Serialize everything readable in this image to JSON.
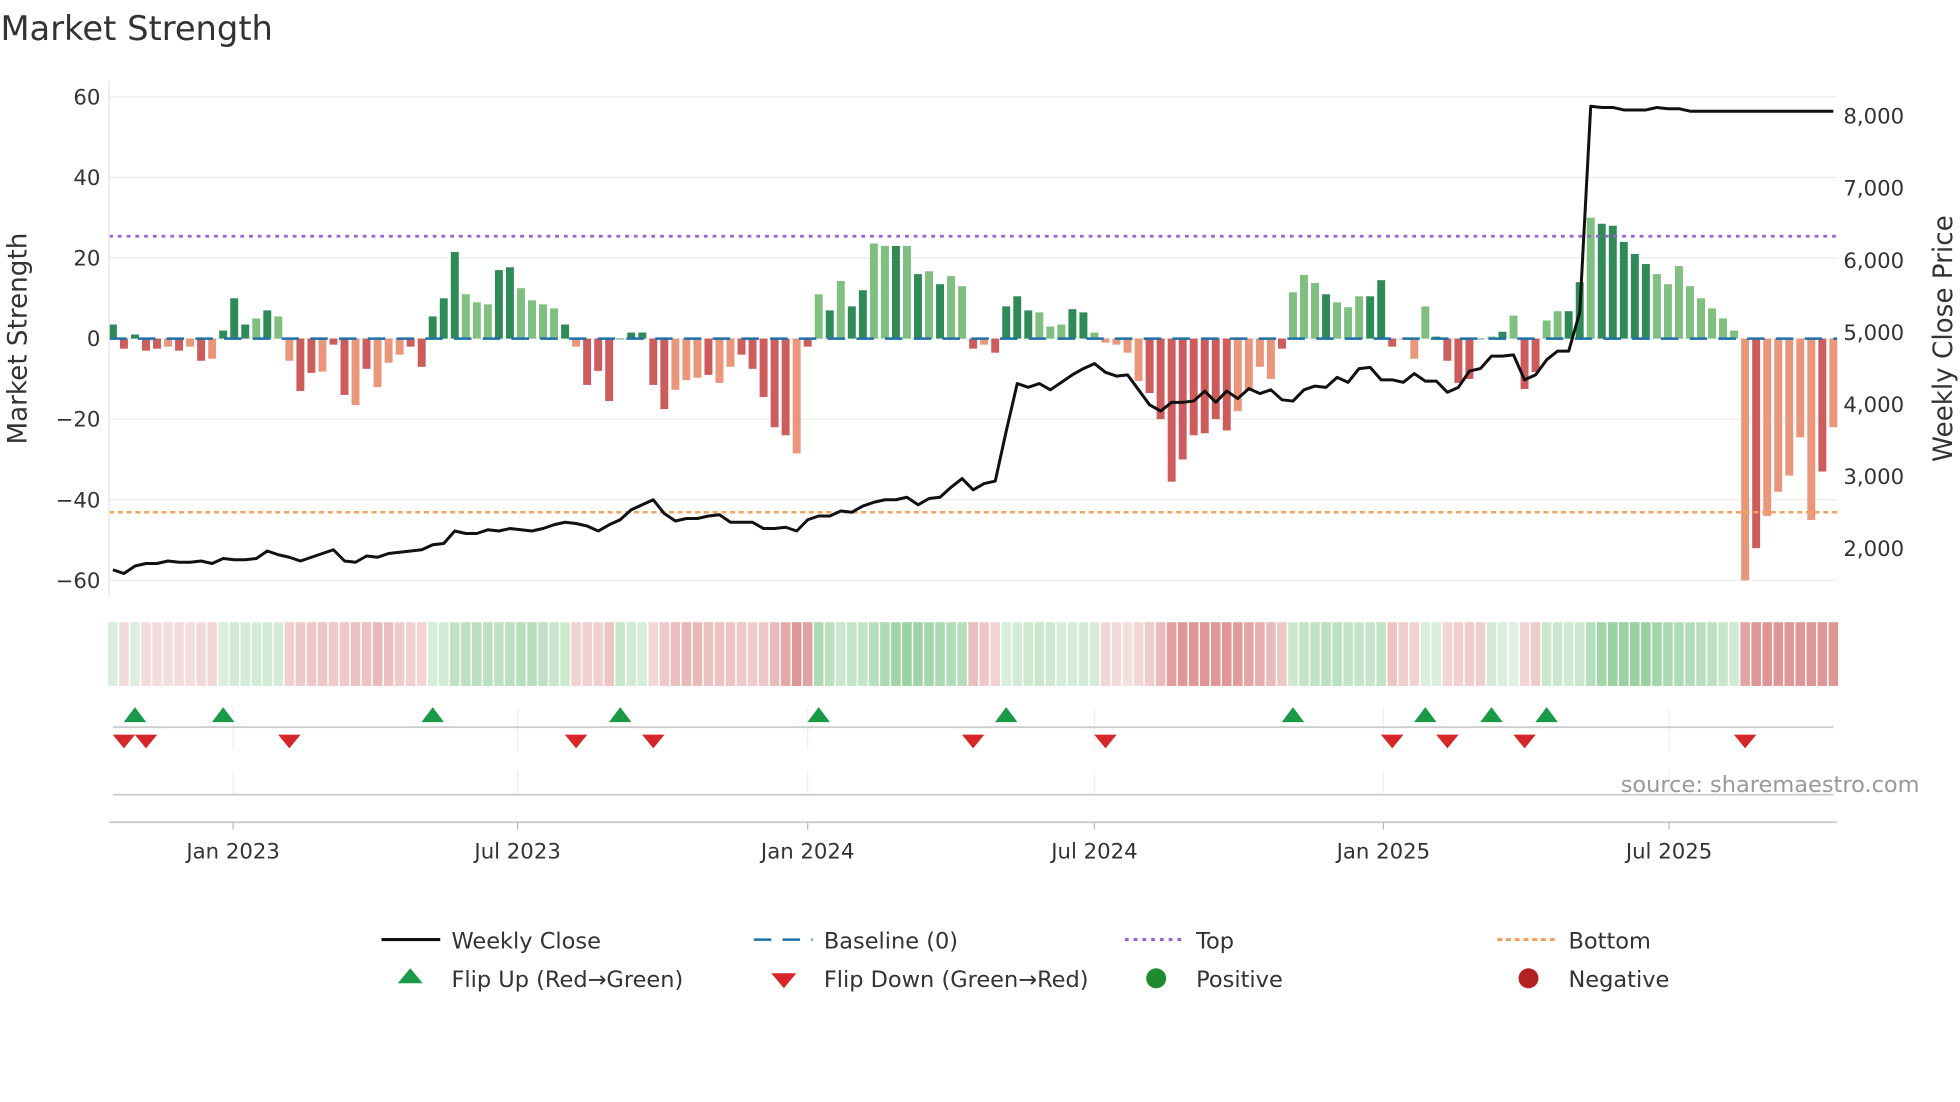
{
  "chart_data": {
    "type": "bar",
    "title": "Market Strength",
    "ylabel": "Market Strength",
    "y2label": "Weekly Close Price",
    "ylim": [
      -63,
      63
    ],
    "y_ticks": [
      60,
      40,
      20,
      0,
      -20,
      -40,
      -60
    ],
    "y_tick_labels": [
      "60",
      "40",
      "20",
      "0",
      "−20",
      "−40",
      "−60"
    ],
    "y2lim": [
      1500,
      8500
    ],
    "y2_ticks": [
      8000,
      7000,
      6000,
      5000,
      4000,
      3000,
      2000
    ],
    "y2_tick_labels": [
      "8,000",
      "7,000",
      "6,000",
      "5,000",
      "4,000",
      "3,000",
      "2,000"
    ],
    "x_ticks": [
      {
        "label": "Jan 2023",
        "week": 10.9
      },
      {
        "label": "Jul 2023",
        "week": 36.7
      },
      {
        "label": "Jan 2024",
        "week": 63.0
      },
      {
        "label": "Jul 2024",
        "week": 89.0
      },
      {
        "label": "Jan 2025",
        "week": 115.2
      },
      {
        "label": "Jul 2025",
        "week": 141.1
      }
    ],
    "top_level": 25.4,
    "bottom_level": -43.1,
    "baseline": 0,
    "strength": [
      3.5,
      -2.5,
      1,
      -3,
      -2.5,
      -2,
      -3,
      -2,
      -5.5,
      -5,
      2,
      10,
      3.5,
      5,
      7,
      5.5,
      -5.5,
      -13,
      -8.5,
      -8.2,
      -1.5,
      -14,
      -16.5,
      -7.5,
      -12,
      -6,
      -4,
      -2,
      -7,
      5.5,
      10,
      21.5,
      11,
      9,
      8.5,
      17,
      17.7,
      12.5,
      9.5,
      8.5,
      7.5,
      3.5,
      -2,
      -11.5,
      -8,
      -15.5,
      0,
      1.5,
      1.5,
      -11.5,
      -17.5,
      -12.7,
      -10.3,
      -9.7,
      -9,
      -11,
      -7,
      -4,
      -7.5,
      -14.5,
      -22,
      -24,
      -28.5,
      -2,
      11,
      7,
      14.3,
      8,
      12,
      23.6,
      23,
      23,
      23,
      16,
      16.7,
      13.5,
      15.5,
      13,
      -2.5,
      -1.5,
      -3.5,
      8,
      10.5,
      7,
      6.5,
      3,
      3.5,
      7.3,
      6.5,
      1.5,
      -1,
      -1.5,
      -3.5,
      -10.5,
      -13.5,
      -20,
      -35.5,
      -30,
      -24,
      -23.5,
      -20,
      -22.8,
      -18,
      -13,
      -7,
      -10,
      -2.5,
      11.5,
      15.8,
      13.8,
      11,
      9,
      7.8,
      10.5,
      10.5,
      14.5,
      -2,
      -0.2,
      -5,
      8,
      0.5,
      -5.5,
      -11,
      -10,
      0,
      0.5,
      1.7,
      5.7,
      -12.5,
      -8.3,
      4.5,
      6.8,
      6.8,
      14,
      30,
      28.5,
      28,
      24,
      21,
      18.5,
      16,
      13.5,
      18,
      13,
      10,
      7.5,
      5,
      2,
      -60,
      -52,
      -44,
      -38,
      -34,
      -24.5,
      -45,
      -33,
      -22
    ],
    "shade": "dddddldldldddldllddlddldllldddddlllddlllldldd0dddddllldlldddddldldlddlldldldlldlddddlllddlllllddddddddlllldllldllldddllldddddldlddllddldddddllllllllldllllldlllllldll",
    "weekly_close": [
      1706,
      1654,
      1758,
      1792,
      1792,
      1827,
      1810,
      1810,
      1827,
      1792,
      1862,
      1844,
      1844,
      1862,
      1966,
      1914,
      1879,
      1827,
      1879,
      1931,
      1983,
      1827,
      1810,
      1896,
      1879,
      1931,
      1948,
      1966,
      1983,
      2052,
      2070,
      2243,
      2208,
      2208,
      2261,
      2243,
      2278,
      2261,
      2243,
      2278,
      2330,
      2365,
      2347,
      2313,
      2243,
      2330,
      2399,
      2538,
      2607,
      2677,
      2486,
      2382,
      2417,
      2417,
      2451,
      2469,
      2365,
      2365,
      2365,
      2278,
      2278,
      2295,
      2243,
      2399,
      2451,
      2451,
      2521,
      2503,
      2590,
      2642,
      2677,
      2677,
      2711,
      2607,
      2694,
      2711,
      2850,
      2971,
      2815,
      2902,
      2937,
      3630,
      4289,
      4237,
      4289,
      4202,
      4306,
      4410,
      4497,
      4567,
      4445,
      4393,
      4410,
      4202,
      3994,
      3908,
      4029,
      4029,
      4046,
      4185,
      4029,
      4185,
      4081,
      4220,
      4150,
      4202,
      4064,
      4046,
      4202,
      4254,
      4237,
      4376,
      4306,
      4497,
      4515,
      4341,
      4341,
      4306,
      4428,
      4324,
      4324,
      4168,
      4237,
      4462,
      4497,
      4671,
      4671,
      4688,
      4341,
      4410,
      4619,
      4740,
      4740,
      5277,
      8139,
      8121,
      8121,
      8087,
      8087,
      8087,
      8121,
      8104,
      8104,
      8069,
      8069,
      8069,
      8069,
      8069,
      8069,
      8069,
      8069,
      8069,
      8069,
      8069,
      8069,
      8069,
      8069
    ],
    "flip_up_weeks": [
      2,
      10,
      29,
      46,
      64,
      81,
      107,
      119,
      125,
      130
    ],
    "flip_down_weeks": [
      1,
      3,
      16,
      42,
      49,
      78,
      90,
      116,
      121,
      128,
      148
    ],
    "legend": {
      "placement": "bottom",
      "items": [
        "Weekly Close",
        "Baseline (0)",
        "Top",
        "Bottom",
        "Flip Up (Red→Green)",
        "Flip Down (Green→Red)",
        "Positive",
        "Negative"
      ]
    },
    "source": "source: sharemaestro.com",
    "colors": {
      "pos_dark": "#2e8b57",
      "pos_light": "#7fbf7f",
      "neg_dark": "#cd5c5c",
      "neg_light": "#e9967a",
      "line": "#111111",
      "baseline": "#1f6fa8",
      "top": "#9b5fd6",
      "bottom": "#f2a360",
      "flip_up": "#1a9a48",
      "flip_down": "#d62728",
      "positive": "#1e8c2e",
      "negative": "#b22222"
    }
  }
}
